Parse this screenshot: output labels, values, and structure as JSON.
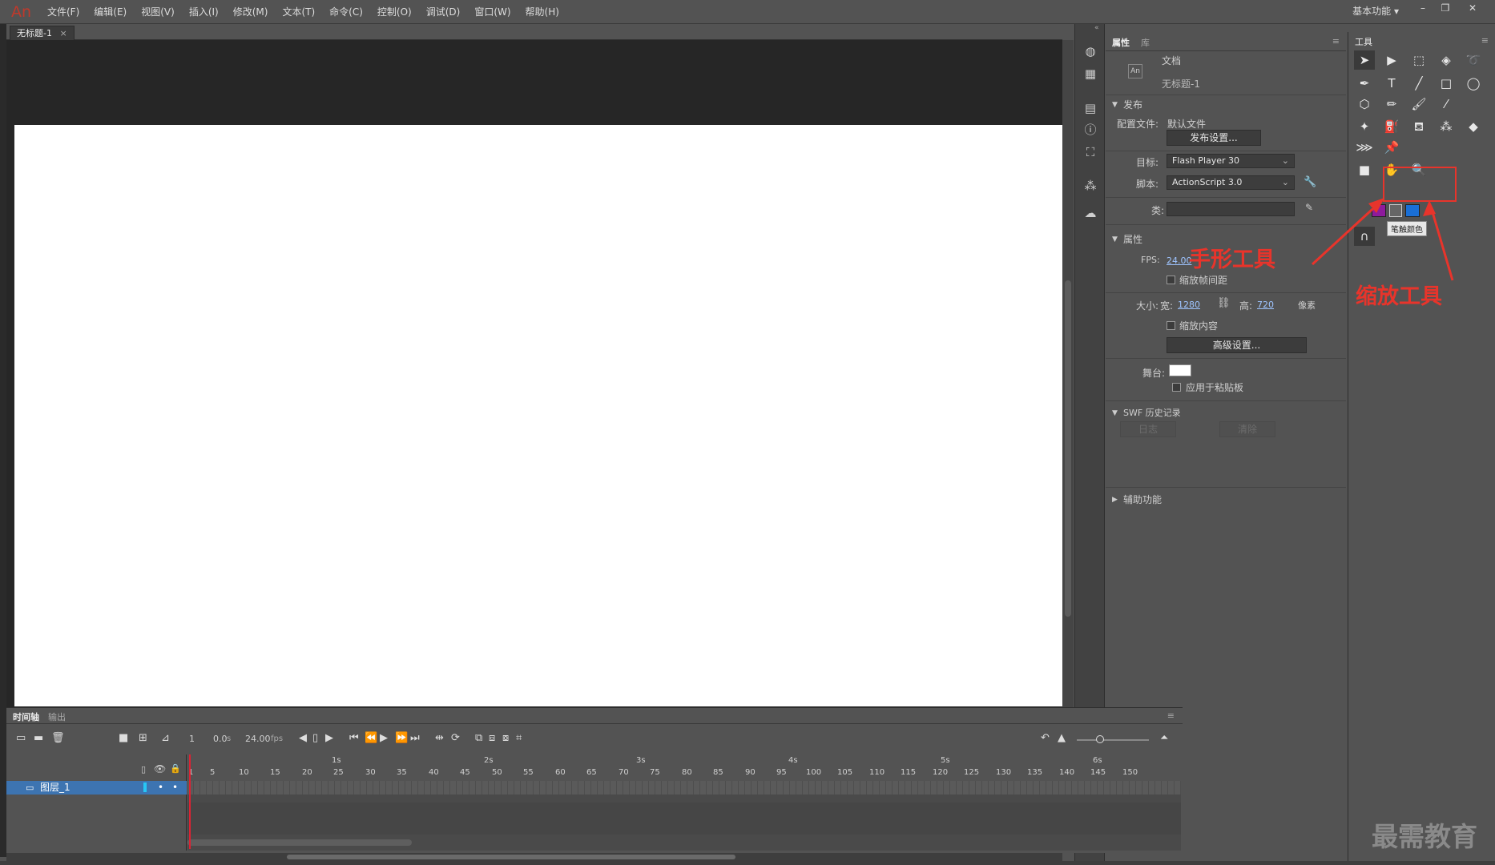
{
  "app": {
    "logo": "An"
  },
  "menu": [
    "文件(F)",
    "编辑(E)",
    "视图(V)",
    "插入(I)",
    "修改(M)",
    "文本(T)",
    "命令(C)",
    "控制(O)",
    "调试(D)",
    "窗口(W)",
    "帮助(H)"
  ],
  "workspace": {
    "label": "基本功能 ▾"
  },
  "window_controls": [
    "–",
    "❐",
    "✕"
  ],
  "document": {
    "tab_label": "无标题-1",
    "tab_close": "×"
  },
  "properties": {
    "tab_properties": "属性",
    "tab_library": "库",
    "doc_type": "文档",
    "doc_name": "无标题-1",
    "publish_header": "发布",
    "profile_label": "配置文件:",
    "profile_value": "默认文件",
    "publish_settings_btn": "发布设置...",
    "target_label": "目标:",
    "target_value": "Flash Player 30",
    "script_label": "脚本:",
    "script_value": "ActionScript 3.0",
    "class_label": "类:",
    "props_header": "属性",
    "fps_label": "FPS:",
    "fps_value": "24.00",
    "scale_spans_label": "缩放帧间距",
    "size_label": "大小:",
    "width_label": "宽:",
    "width_value": "1280",
    "height_label": "高:",
    "height_value": "720",
    "unit": "像素",
    "scale_content_label": "缩放内容",
    "advanced_btn": "高级设置...",
    "stage_label": "舞台:",
    "stage_color": "#ffffff",
    "apply_pasteboard_label": "应用于粘贴板",
    "swf_history_header": "SWF 历史记录",
    "log_btn": "日志",
    "clear_btn": "清除",
    "accessibility_header": "辅助功能"
  },
  "tools": {
    "title": "工具",
    "stroke_color": "#8e1a9c",
    "fill_color": "#1a6fd6",
    "tooltip": "笔触颜色"
  },
  "annotations": {
    "hand_tool": "手形工具",
    "zoom_tool": "缩放工具",
    "color": "#e8342b"
  },
  "watermark": "最需教育",
  "timeline": {
    "tab_timeline": "时间轴",
    "tab_output": "输出",
    "current_frame": "1",
    "elapsed": "0.0",
    "elapsed_unit": "s",
    "fps": "24.00",
    "fps_unit": "fps",
    "layer_name": "图层_1",
    "seconds": [
      "1s",
      "2s",
      "3s",
      "4s",
      "5s",
      "6s"
    ],
    "frame_ticks": [
      "1",
      "5",
      "10",
      "15",
      "20",
      "25",
      "30",
      "35",
      "40",
      "45",
      "50",
      "55",
      "60",
      "65",
      "70",
      "75",
      "80",
      "85",
      "90",
      "95",
      "100",
      "105",
      "110",
      "115",
      "120",
      "125",
      "130",
      "135",
      "140",
      "145",
      "150"
    ]
  }
}
